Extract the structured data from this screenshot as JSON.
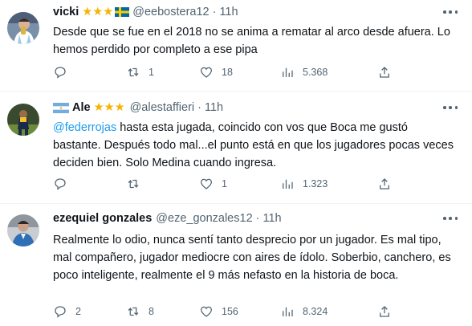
{
  "tweets": [
    {
      "name": "vicki",
      "stars": "★★★",
      "flag": "sweden-flag",
      "handle": "@eebostera12",
      "dot": "·",
      "time": "11h",
      "text": "Desde que se fue en el 2018 no se anima a rematar al arco desde afuera. Lo hemos perdido por completo a ese pipa",
      "replies": "",
      "retweets": "1",
      "likes": "18",
      "views": "5.368"
    },
    {
      "name": "Ale",
      "stars": "★★★",
      "flag": "argentina-flag",
      "handle": "@alestaffieri",
      "dot": "·",
      "time": "11h",
      "mention": "@federrojas",
      "text": " hasta esta jugada, coincido con vos que Boca me gustó bastante. Después todo mal...el punto está en que los jugadores pocas veces deciden bien. Solo Medina cuando ingresa.",
      "replies": "",
      "retweets": "",
      "likes": "1",
      "views": "1.323"
    },
    {
      "name": "ezequiel gonzales",
      "handle": "@eze_gonzales12",
      "dot": "·",
      "time": "11h",
      "text": "Realmente lo odio, nunca sentí tanto desprecio por un jugador. Es mal tipo, mal compañero, jugador mediocre con aires de ídolo. Soberbio, canchero, es poco inteligente, realmente el 9 más nefasto en la historia de boca.",
      "replies": "2",
      "retweets": "8",
      "likes": "156",
      "views": "8.324"
    }
  ],
  "colors": {
    "link": "#1d9bf0",
    "muted": "#536471",
    "star": "#f4b400"
  }
}
